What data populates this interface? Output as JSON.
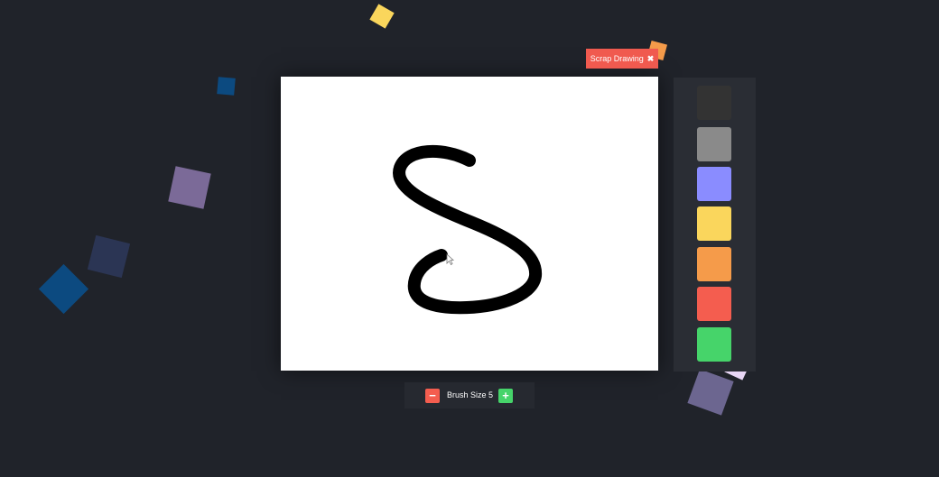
{
  "canvas": {
    "stroke_color": "#000000",
    "background": "#ffffff"
  },
  "scrap_button": {
    "label": "Scrap Drawing",
    "icon": "close-icon",
    "color": "#f05a4f"
  },
  "palette": {
    "colors": [
      "#333333",
      "#8a8a8a",
      "#8a8cff",
      "#fad65c",
      "#f59b4a",
      "#f45d4f",
      "#46d46a"
    ]
  },
  "brush": {
    "label": "Brush Size",
    "size": "5",
    "decrease_icon": "minus-icon",
    "increase_icon": "plus-icon",
    "decrease_color": "#f45d4f",
    "increase_color": "#46d46a"
  },
  "decorations": {
    "colors": [
      "#fad65c",
      "#f59b4a",
      "#0c4a80",
      "#7b6a98",
      "#2b3554",
      "#6c6690",
      "#e8d6f5"
    ]
  }
}
